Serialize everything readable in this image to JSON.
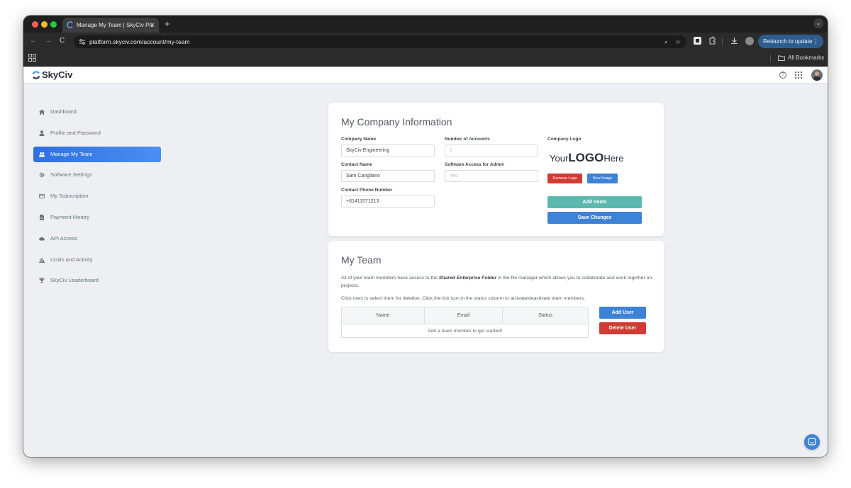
{
  "browser": {
    "tab_title": "Manage My Team | SkyCiv Pla",
    "tab_close": "×",
    "new_tab": "+",
    "url": "platform.skyciv.com/account/my-team",
    "relaunch_label": "Relaunch to update",
    "relaunch_menu": "⋮",
    "bookmarks_label": "All Bookmarks"
  },
  "app": {
    "brand": "SkyCiv",
    "help_glyph": "?"
  },
  "sidebar": {
    "items": [
      {
        "label": "Dashboard",
        "icon": "dashboard-icon"
      },
      {
        "label": "Profile and Password",
        "icon": "user-icon"
      },
      {
        "label": "Manage My Team",
        "icon": "users-icon",
        "active": true
      },
      {
        "label": "Software Settings",
        "icon": "gear-icon"
      },
      {
        "label": "My Subscription",
        "icon": "credit-card-icon"
      },
      {
        "label": "Payment History",
        "icon": "document-icon"
      },
      {
        "label": "API Access",
        "icon": "cloud-icon"
      },
      {
        "label": "Limits and Activity",
        "icon": "bar-chart-icon"
      },
      {
        "label": "SkyCiv Leaderboard",
        "icon": "trophy-icon"
      }
    ]
  },
  "company": {
    "title": "My Company Information",
    "company_name_label": "Company Name",
    "company_name_value": "SkyCiv Engineering",
    "contact_name_label": "Contact Name",
    "contact_name_value": "Sam Cangliano",
    "phone_label": "Contact Phone Number",
    "phone_value": "+61411571213",
    "accounts_label": "Number of Accounts",
    "accounts_value": "1",
    "admin_access_label": "Software Access for Admin",
    "admin_access_value": "Yes",
    "logo_label": "Company Logo",
    "logo_your": "Your",
    "logo_logo": "LOGO",
    "logo_here": "Here",
    "remove_logo": "Remove Logo",
    "new_image": "New Image",
    "add_seats": "Add Seats",
    "save_changes": "Save Changes"
  },
  "team": {
    "title": "My Team",
    "desc_prefix": "All of your team members have access to the ",
    "desc_folder": "Shared Enterprise Folder",
    "desc_suffix": " in the file manager which allows you to collaborate and work together on projects.",
    "instructions": "Click rows to select them for deletion. Click the tick icon in the status column to activate/deactivate team members.",
    "columns": [
      "Name",
      "Email",
      "Status"
    ],
    "empty_message": "Add a team member to get started!",
    "add_user": "Add User",
    "delete_user": "Delete User"
  },
  "colors": {
    "accent_blue": "#3e82d6",
    "danger_red": "#d23a34",
    "teal": "#5bb9ae",
    "sidebar_active": "#2f6fe0"
  }
}
